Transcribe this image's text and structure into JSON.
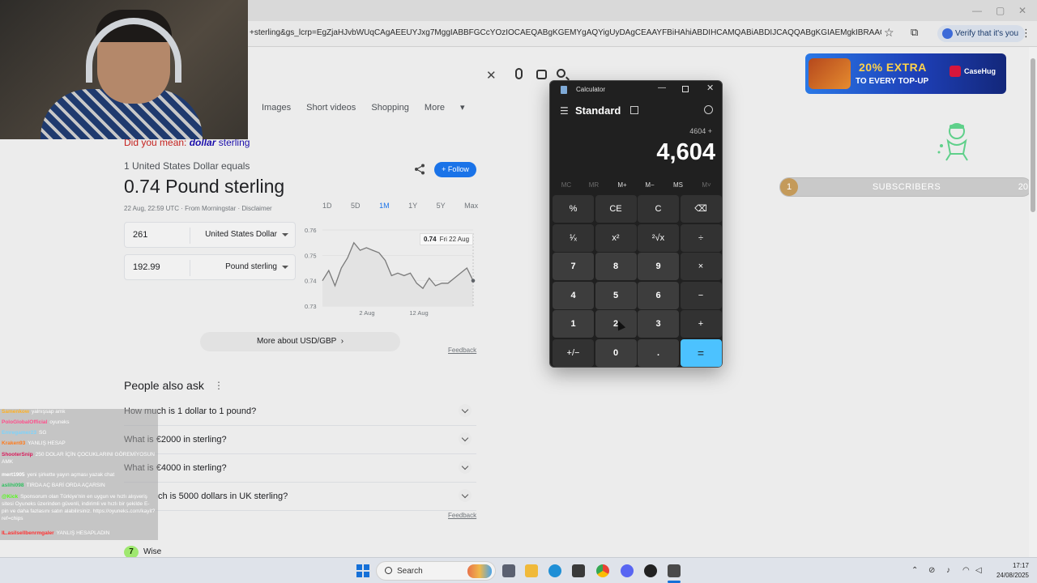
{
  "browser": {
    "url": "+sterling&gs_lcrp=EgZjaHJvbWUqCAgAEEUYJxg7MggIABBFGCcYOzIOCAEQABgKGEMYgAQYigUyDAgCEAAYFBiHAhiABDIHCAMQABiABDIJCAQQABgKGIAEMgkIBRAAGAoYgAQyCQgGEAAY...",
    "verify_label": "Verify that it's you"
  },
  "search": {
    "tabs": [
      "Images",
      "Short videos",
      "Shopping",
      "More"
    ],
    "did_you_mean_prefix": "Did you mean:",
    "did_you_mean_bold": "dollar",
    "did_you_mean_rest": "sterling"
  },
  "converter": {
    "lead": "1 United States Dollar equals",
    "result": "0.74 Pound sterling",
    "meta": "22 Aug, 22:59 UTC · From Morningstar · Disclaimer",
    "follow_label": "Follow",
    "from_amount": "261",
    "from_currency": "United States Dollar",
    "to_amount": "192.99",
    "to_currency": "Pound sterling",
    "range_tabs": [
      "1D",
      "5D",
      "1M",
      "1Y",
      "5Y",
      "Max"
    ],
    "active_range": "1M",
    "tooltip_value": "0.74",
    "tooltip_date": "Fri 22 Aug",
    "more_label": "More about USD/GBP",
    "feedback_label": "Feedback"
  },
  "chart_data": {
    "type": "line",
    "y_ticks": [
      "0.76",
      "0.75",
      "0.74",
      "0.73"
    ],
    "ylim": [
      0.73,
      0.76
    ],
    "x_ticks": [
      "2 Aug",
      "12 Aug"
    ],
    "series": [
      {
        "values": [
          0.74,
          0.744,
          0.738,
          0.745,
          0.749,
          0.755,
          0.752,
          0.753,
          0.752,
          0.751,
          0.748,
          0.742,
          0.743,
          0.742,
          0.743,
          0.739,
          0.737,
          0.741,
          0.738,
          0.739,
          0.739,
          0.741,
          0.743,
          0.745,
          0.74
        ]
      }
    ]
  },
  "paa": {
    "title": "People also ask",
    "questions": [
      "How much is 1 dollar to 1 pound?",
      "What is €2000 in sterling?",
      "What is €4000 in sterling?",
      "ch is 5000 dollars in UK sterling?"
    ],
    "feedback_label": "Feedback",
    "wise_label": "Wise"
  },
  "chat": [
    {
      "user": "Samenkow",
      "msg": "yalnışsap amk",
      "color": "#ffb020"
    },
    {
      "user": "PoloGlobalOfficial",
      "msg": "oyuneks",
      "color": "#ff4d8a"
    },
    {
      "user": "Emregamer23",
      "msg": "SG",
      "color": "#7dd3fc"
    },
    {
      "user": "Kraken93",
      "msg": "YANLIŞ HESAP",
      "color": "#ff7a1a"
    },
    {
      "user": "ShooterSnip",
      "msg": "250 DOLAR İÇİN ÇOCUKLARINI GÖREMİYOSUN AMK",
      "color": "#d91a5a"
    },
    {
      "user": "mert1905",
      "msg": "yeni şirkette yayın açması yazak chat",
      "color": "#ffffff"
    },
    {
      "user": "aslihi098",
      "msg": "TIRDA AÇ BARİ ORDA AÇARSIN",
      "color": "#30c060"
    },
    {
      "user": "@Kick",
      "msg": "Sponsorum olan Türkiye'nin en uygun ve hızlı alışveriş sitesi Oyuneks üzerinden güvenli, indirimli ve hızlı bir şekilde E-pin ve daha fazlasını satın alabilirsiniz. https://oyuneks.com/kayit?ref=chips",
      "color": "#53fc18"
    },
    {
      "user": "IL.asilsellbenrmgaler",
      "msg": "YANLIŞ HESAPLADIN",
      "color": "#ff3030"
    }
  ],
  "overlay": {
    "ad_big": "20% EXTRA",
    "ad_sub": "TO EVERY TOP-UP",
    "ad_brand": "CaseHug",
    "subs_from": "1",
    "subs_label": "SUBSCRIBERS",
    "subs_to": "20",
    "subs_progress": 0.03
  },
  "calculator": {
    "title": "Calculator",
    "mode": "Standard",
    "expression": "4604 +",
    "display": "4,604",
    "memory": [
      "MC",
      "MR",
      "M+",
      "M−",
      "MS",
      "M˅"
    ],
    "keys": [
      [
        "%",
        "CE",
        "C",
        "⌫"
      ],
      [
        "¹⁄ₓ",
        "x²",
        "²√x",
        "÷"
      ],
      [
        "7",
        "8",
        "9",
        "×"
      ],
      [
        "4",
        "5",
        "6",
        "−"
      ],
      [
        "1",
        "2",
        "3",
        "+"
      ],
      [
        "+/−",
        "0",
        ".",
        "="
      ]
    ]
  },
  "taskbar": {
    "search_label": "Search",
    "time": "17:17",
    "date": "24/08/2025"
  }
}
